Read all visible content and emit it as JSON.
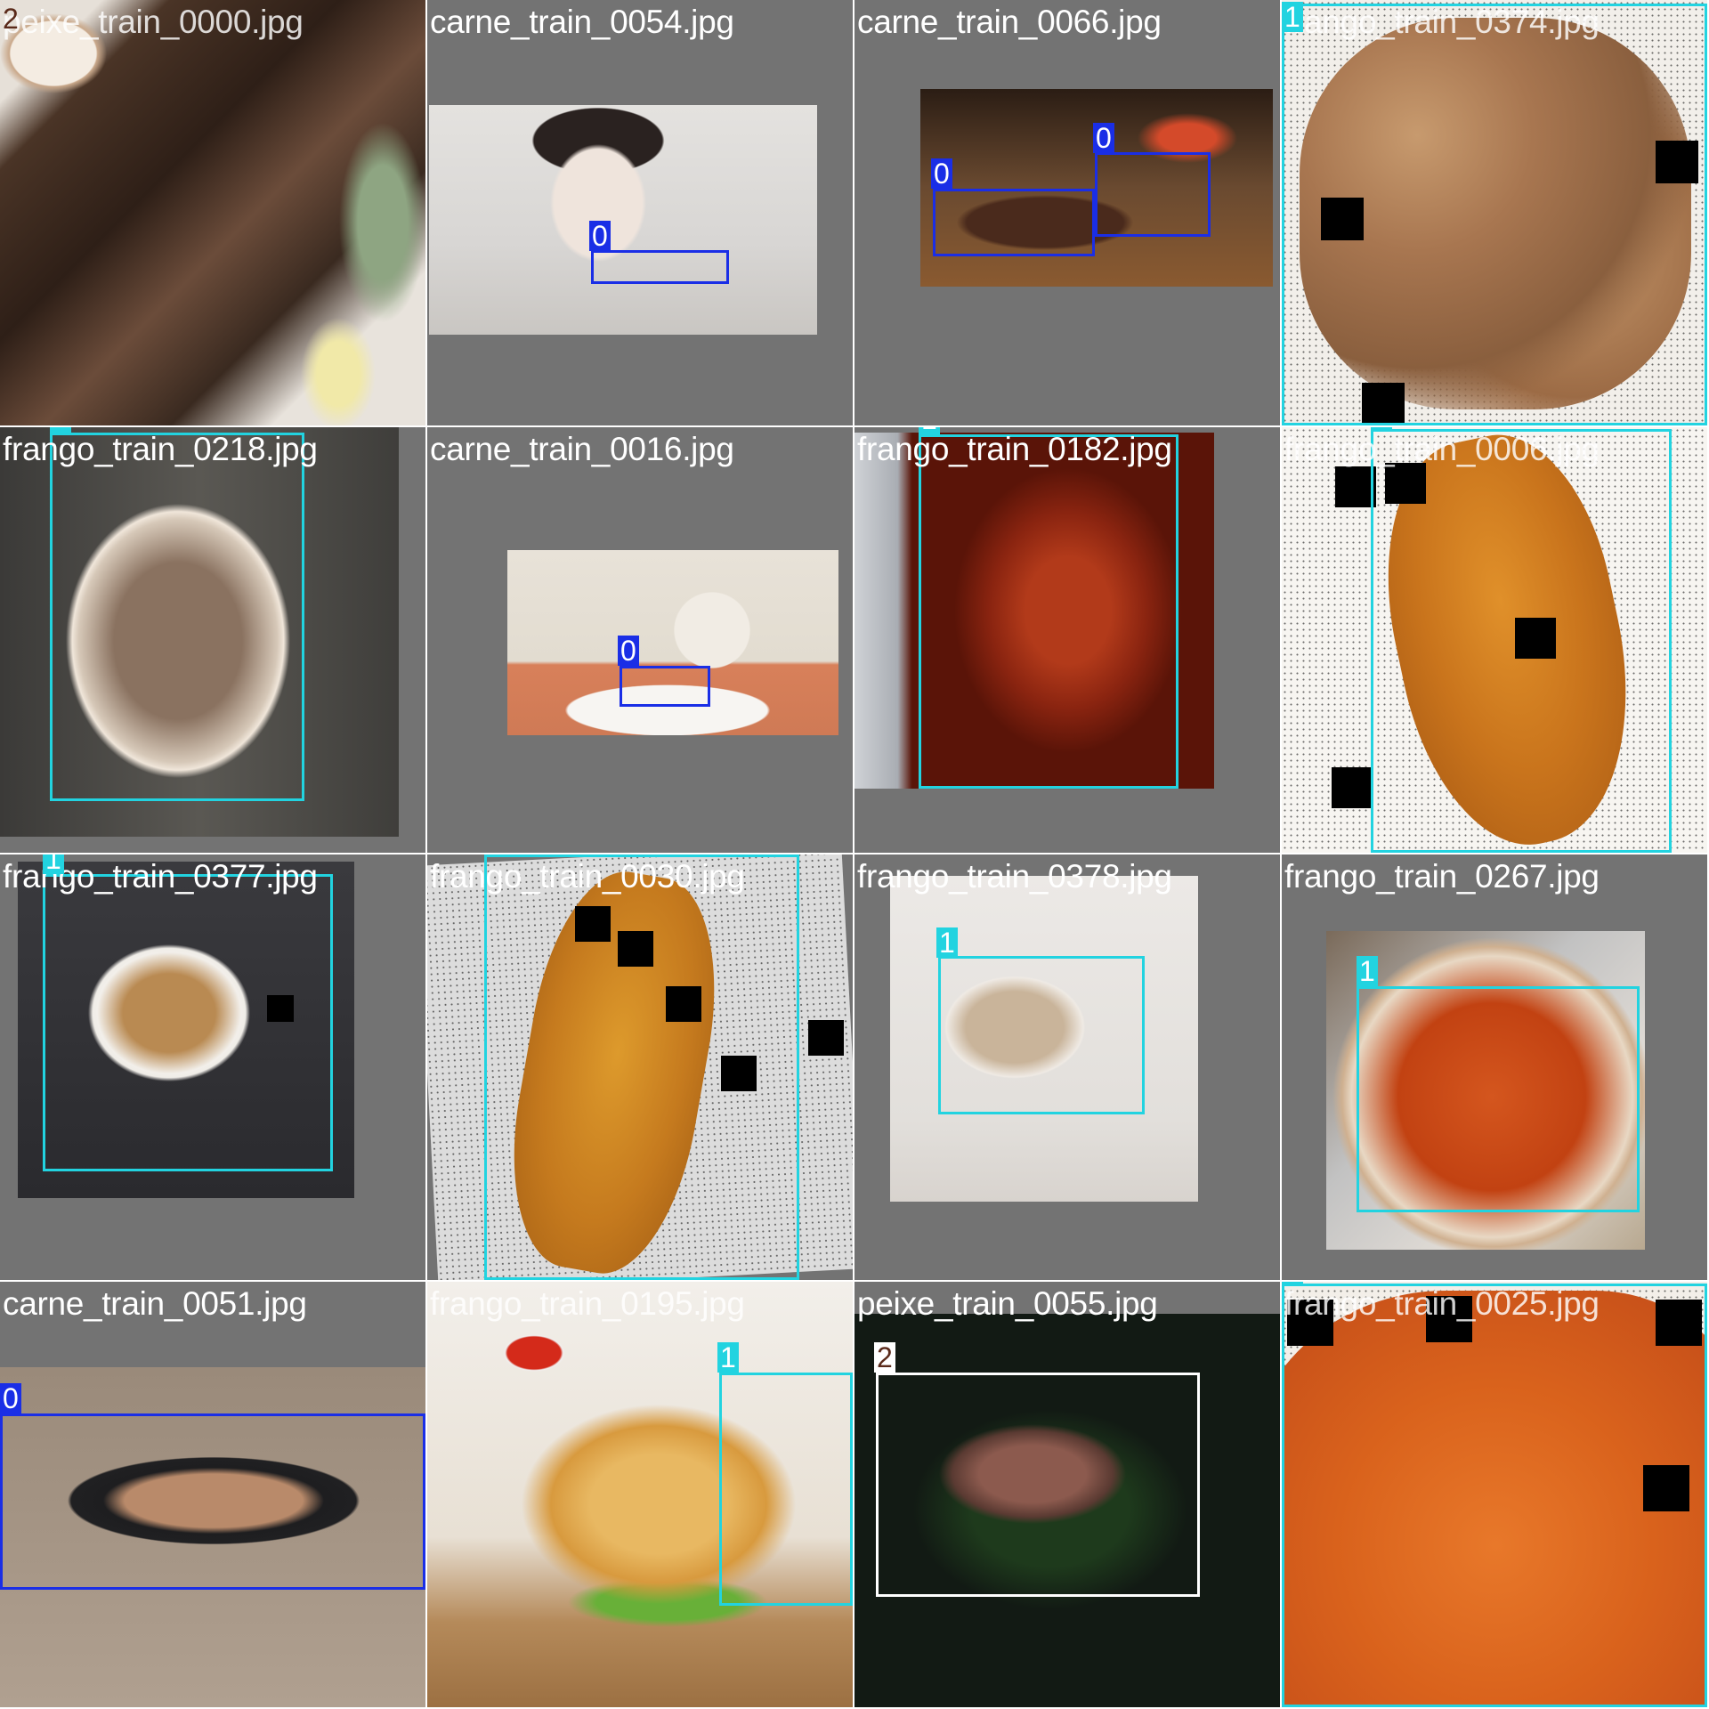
{
  "grid": {
    "tiles": [
      {
        "filename": "peixe_train_0000.jpg",
        "labels": [
          "2"
        ],
        "label_pale": true
      },
      {
        "filename": "carne_train_0054.jpg",
        "labels": [
          "0"
        ]
      },
      {
        "filename": "carne_train_0066.jpg",
        "labels": [
          "0",
          "0"
        ]
      },
      {
        "filename": "frango_train_0374.jpg",
        "labels": [
          "1"
        ],
        "label_pale": true
      },
      {
        "filename": "frango_train_0218.jpg",
        "labels": [
          "1"
        ]
      },
      {
        "filename": "carne_train_0016.jpg",
        "labels": [
          "0"
        ]
      },
      {
        "filename": "frango_train_0182.jpg",
        "labels": [
          "1"
        ]
      },
      {
        "filename": "frango_train_0006.jpg",
        "labels": [
          "1"
        ],
        "label_pale": true
      },
      {
        "filename": "frango_train_0377.jpg",
        "labels": [
          "1"
        ]
      },
      {
        "filename": "frango_train_0030.jpg",
        "labels": [
          "1"
        ]
      },
      {
        "filename": "frango_train_0378.jpg",
        "labels": [
          "1"
        ]
      },
      {
        "filename": "frango_train_0267.jpg",
        "labels": [
          "1"
        ]
      },
      {
        "filename": "carne_train_0051.jpg",
        "labels": [
          "0"
        ]
      },
      {
        "filename": "frango_train_0195.jpg",
        "labels": [
          "1"
        ],
        "label_pale": true
      },
      {
        "filename": "peixe_train_0055.jpg",
        "labels": [
          "2"
        ]
      },
      {
        "filename": "frango_train_0025.jpg",
        "labels": [
          "1"
        ],
        "label_pale": true
      }
    ]
  },
  "class_colors": {
    "0": "#1a2ee6",
    "1": "#22d3e0",
    "2": "#ffffff"
  },
  "tag_colors": {
    "0": "#1a2ee6",
    "1": "#22d3e0",
    "2": "#ffffff"
  }
}
